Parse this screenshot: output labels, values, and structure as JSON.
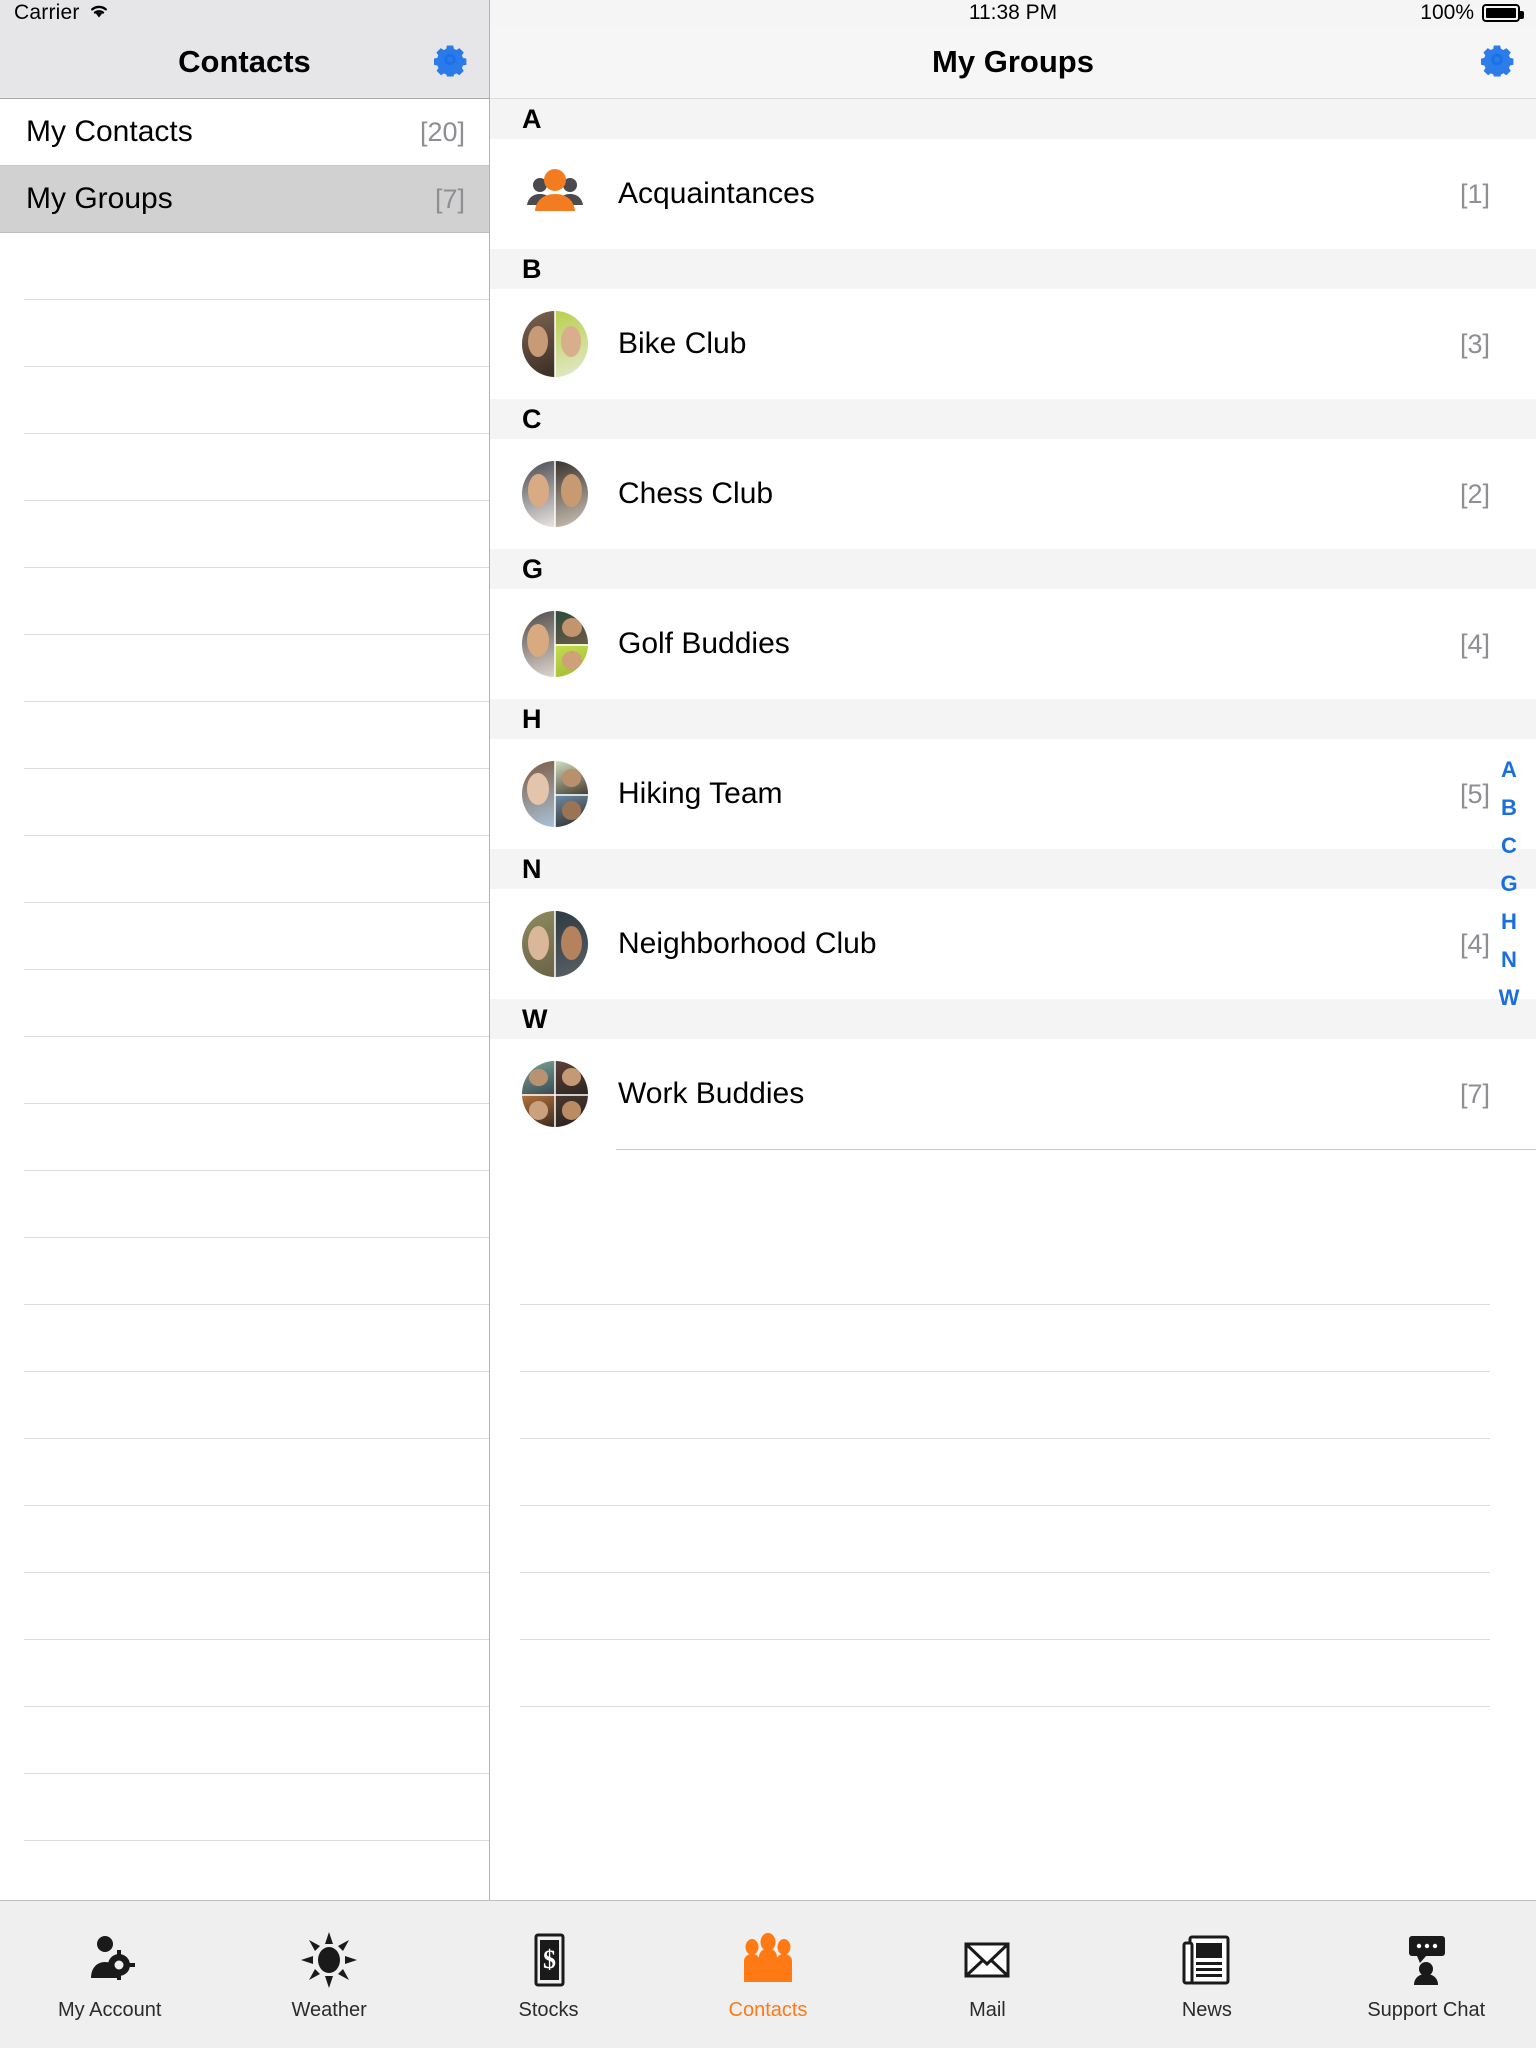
{
  "left": {
    "status": {
      "carrier": "Carrier",
      "wifi_icon": "wifi-icon"
    },
    "navbar": {
      "title": "Contacts",
      "settings_icon": "gear-icon"
    },
    "rows": [
      {
        "label": "My Contacts",
        "count": "[20]",
        "selected": false
      },
      {
        "label": "My Groups",
        "count": "[7]",
        "selected": true
      }
    ]
  },
  "right": {
    "status": {
      "time": "11:38 PM",
      "battery_pct": "100%",
      "battery_icon": "battery-full-icon"
    },
    "navbar": {
      "title": "My Groups",
      "settings_icon": "gear-icon"
    },
    "sections": [
      {
        "letter": "A",
        "items": [
          {
            "name": "Acquaintances",
            "count": "[1]",
            "avatar": "group-people-icon"
          }
        ]
      },
      {
        "letter": "B",
        "items": [
          {
            "name": "Bike Club",
            "count": "[3]",
            "avatar": "photo-split-2"
          }
        ]
      },
      {
        "letter": "C",
        "items": [
          {
            "name": "Chess Club",
            "count": "[2]",
            "avatar": "photo-split-2"
          }
        ]
      },
      {
        "letter": "G",
        "items": [
          {
            "name": "Golf Buddies",
            "count": "[4]",
            "avatar": "photo-split-3"
          }
        ]
      },
      {
        "letter": "H",
        "items": [
          {
            "name": "Hiking Team",
            "count": "[5]",
            "avatar": "photo-split-3"
          }
        ]
      },
      {
        "letter": "N",
        "items": [
          {
            "name": "Neighborhood Club",
            "count": "[4]",
            "avatar": "photo-split-2"
          }
        ]
      },
      {
        "letter": "W",
        "items": [
          {
            "name": "Work Buddies",
            "count": "[7]",
            "avatar": "photo-split-4"
          }
        ]
      }
    ],
    "index_letters": [
      "A",
      "B",
      "C",
      "G",
      "H",
      "N",
      "W"
    ]
  },
  "tabbar": {
    "items": [
      {
        "label": "My Account",
        "icon": "person-gear-icon",
        "active": false
      },
      {
        "label": "Weather",
        "icon": "sun-icon",
        "active": false
      },
      {
        "label": "Stocks",
        "icon": "dollar-chart-icon",
        "active": false
      },
      {
        "label": "Contacts",
        "icon": "people-group-icon",
        "active": true
      },
      {
        "label": "Mail",
        "icon": "envelope-icon",
        "active": false
      },
      {
        "label": "News",
        "icon": "newspaper-icon",
        "active": false
      },
      {
        "label": "Support Chat",
        "icon": "support-chat-icon",
        "active": false
      }
    ]
  },
  "colors": {
    "accent_orange": "#ff7a14",
    "link_blue": "#1a6fdd",
    "gear_blue": "#1a72e8",
    "selected_row": "#d1d1d1",
    "section_header_bg": "#f4f4f4",
    "secondary_text": "#8e8e93"
  }
}
